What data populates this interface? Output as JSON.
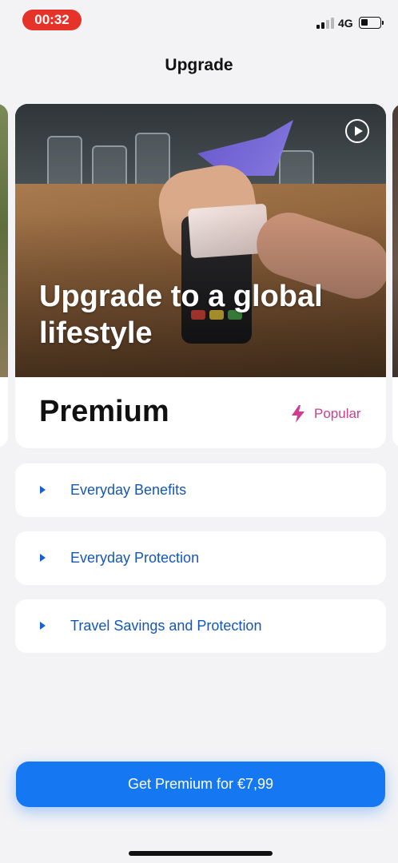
{
  "status_bar": {
    "time": "00:32",
    "network": "4G"
  },
  "header": {
    "title": "Upgrade"
  },
  "plan_card": {
    "hero_title": "Upgrade to a global lifestyle",
    "plan_name": "Premium",
    "badge": "Popular",
    "badge_color": "#cc3f8f",
    "play_icon": "play-icon"
  },
  "benefits": [
    {
      "label": "Everyday Benefits",
      "icon": "chevron-right-icon"
    },
    {
      "label": "Everyday Protection",
      "icon": "chevron-right-icon"
    },
    {
      "label": "Travel Savings and Protection",
      "icon": "chevron-right-icon"
    }
  ],
  "cta": {
    "label": "Get Premium for €7,99",
    "color": "#1677f2"
  },
  "colors": {
    "background": "#f3f3f6",
    "time_pill": "#e5332a",
    "link_blue": "#1557b5"
  }
}
